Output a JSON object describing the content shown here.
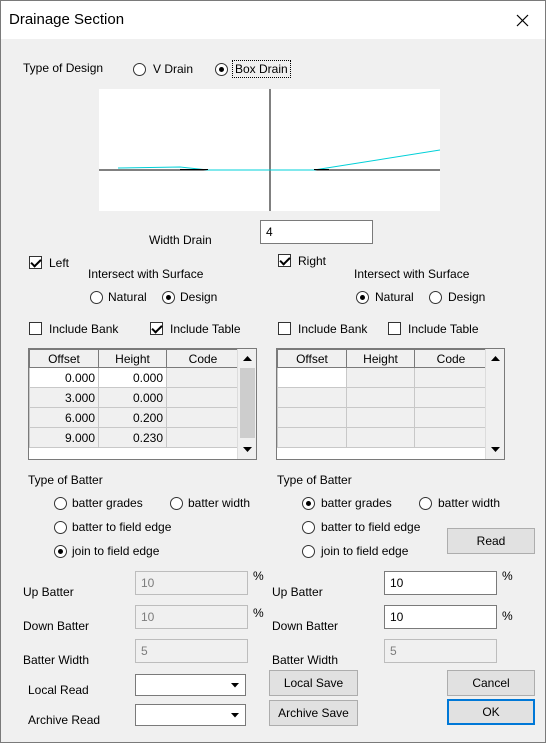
{
  "window": {
    "title": "Drainage Section"
  },
  "design": {
    "label": "Type of Design",
    "options": [
      "V Drain",
      "Box Drain"
    ],
    "selected": "Box Drain"
  },
  "width_drain": {
    "label": "Width Drain",
    "value": "4"
  },
  "left": {
    "label": "Left",
    "checked": true,
    "intersect_label": "Intersect with Surface",
    "intersect_options": [
      "Natural",
      "Design"
    ],
    "intersect_selected": "Design",
    "include_bank_label": "Include Bank",
    "include_bank": false,
    "include_table_label": "Include Table",
    "include_table": true,
    "table": {
      "columns": [
        "Offset",
        "Height",
        "Code"
      ],
      "rows": [
        [
          "0.000",
          "0.000",
          ""
        ],
        [
          "3.000",
          "0.000",
          ""
        ],
        [
          "6.000",
          "0.200",
          ""
        ],
        [
          "9.000",
          "0.230",
          ""
        ]
      ]
    },
    "batter_type_label": "Type of Batter",
    "batter_options": [
      "batter grades",
      "batter width",
      "batter to field edge",
      "join to field edge"
    ],
    "batter_selected": "join to field edge",
    "up_batter": {
      "label": "Up Batter",
      "value": "10",
      "unit": "%"
    },
    "down_batter": {
      "label": "Down Batter",
      "value": "10",
      "unit": "%"
    },
    "batter_width": {
      "label": "Batter Width",
      "value": "5"
    }
  },
  "right": {
    "label": "Right",
    "checked": true,
    "intersect_label": "Intersect with Surface",
    "intersect_options": [
      "Natural",
      "Design"
    ],
    "intersect_selected": "Natural",
    "include_bank_label": "Include Bank",
    "include_bank": false,
    "include_table_label": "Include Table",
    "include_table": false,
    "table": {
      "columns": [
        "Offset",
        "Height",
        "Code"
      ],
      "rows": [
        [
          "",
          "",
          ""
        ],
        [
          "",
          "",
          ""
        ],
        [
          "",
          "",
          ""
        ],
        [
          "",
          "",
          ""
        ]
      ]
    },
    "batter_type_label": "Type of Batter",
    "batter_options": [
      "batter grades",
      "batter width",
      "batter to field edge",
      "join to field edge"
    ],
    "batter_selected": "batter grades",
    "up_batter": {
      "label": "Up Batter",
      "value": "10",
      "unit": "%"
    },
    "down_batter": {
      "label": "Down Batter",
      "value": "10",
      "unit": "%"
    },
    "batter_width": {
      "label": "Batter Width",
      "value": "5"
    }
  },
  "bottom": {
    "local_read_label": "Local Read",
    "local_read_value": "",
    "archive_read_label": "Archive Read",
    "archive_read_value": "",
    "local_save": "Local Save",
    "archive_save": "Archive Save",
    "read": "Read",
    "cancel": "Cancel",
    "ok": "OK"
  },
  "colors": {
    "preview_line": "#00d0d8",
    "default_button_border": "#0078d7"
  }
}
